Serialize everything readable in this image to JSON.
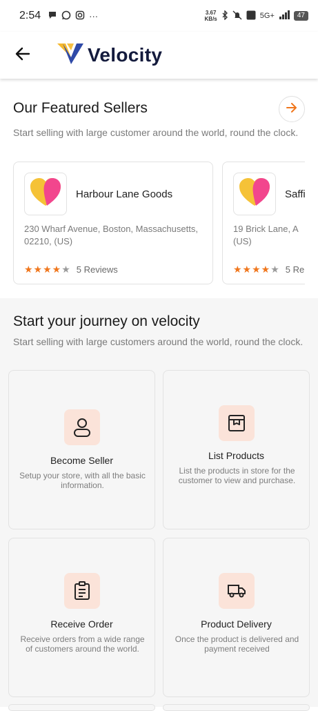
{
  "status": {
    "time": "2:54",
    "speed_top": "3.67",
    "speed_bottom": "KB/s",
    "network": "5G+",
    "battery": "47"
  },
  "app": {
    "brand": "Velocity"
  },
  "featured": {
    "title": "Our Featured Sellers",
    "subtitle": "Start selling with large customer around the world, round the clock.",
    "sellers": [
      {
        "name": "Harbour Lane Goods",
        "address": "230 Wharf Avenue, Boston, Massachusetts, 02210, (US)",
        "reviews": "5 Reviews",
        "rating": 4,
        "max": 5
      },
      {
        "name": "Saffi",
        "address": "19 Brick Lane, A (US)",
        "reviews": "5 Re",
        "rating": 4,
        "max": 5
      }
    ]
  },
  "journey": {
    "title": "Start your journey on velocity",
    "subtitle": "Start selling with large customers around the world, round the clock.",
    "cards": [
      {
        "title": "Become Seller",
        "desc": "Setup your store, with all the basic information.",
        "icon": "user-icon"
      },
      {
        "title": "List Products",
        "desc": "List the products in store for the customer to view and purchase.",
        "icon": "box-icon"
      },
      {
        "title": "Receive Order",
        "desc": "Receive orders from a wide range of customers around the world.",
        "icon": "clipboard-icon"
      },
      {
        "title": "Product Delivery",
        "desc": "Once the product is delivered and payment received",
        "icon": "truck-icon"
      }
    ]
  },
  "colors": {
    "accent": "#f0761c",
    "icon_bg": "#fbe3d9",
    "brand_navy": "#141b3d",
    "logo_yellow": "#f5b82e",
    "logo_blue": "#2f4aa8"
  }
}
